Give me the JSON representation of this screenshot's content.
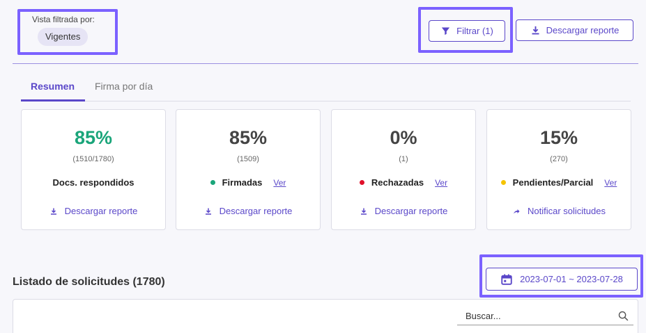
{
  "filter": {
    "label": "Vista filtrada por:",
    "chip": "Vigentes"
  },
  "toolbar": {
    "filter_button": "Filtrar (1)",
    "download_button": "Descargar reporte"
  },
  "tabs": [
    {
      "label": "Resumen",
      "active": true
    },
    {
      "label": "Firma por día",
      "active": false
    }
  ],
  "cards": [
    {
      "percent": "85%",
      "detail": "(1510/1780)",
      "label": "Docs. respondidos",
      "dot_color": "",
      "link": "",
      "action": "Descargar reporte",
      "action_icon": "download-icon"
    },
    {
      "percent": "85%",
      "detail": "(1509)",
      "label": "Firmadas",
      "dot_color": "#1aa57a",
      "link": "Ver",
      "action": "Descargar reporte",
      "action_icon": "download-icon"
    },
    {
      "percent": "0%",
      "detail": "(1)",
      "label": "Rechazadas",
      "dot_color": "#e0102a",
      "link": "Ver",
      "action": "Descargar reporte",
      "action_icon": "download-icon"
    },
    {
      "percent": "15%",
      "detail": "(270)",
      "label": "Pendientes/Parcial",
      "dot_color": "#f5c400",
      "link": "Ver",
      "action": "Notificar solicitudes",
      "action_icon": "share-arrow-icon"
    }
  ],
  "list": {
    "title": "Listado de solicitudes (1780)"
  },
  "date_range": {
    "label": "2023-07-01 ~ 2023-07-28"
  },
  "search": {
    "placeholder": "Buscar..."
  },
  "colors": {
    "accent": "#5a47c9",
    "highlight": "#7b61ff",
    "success": "#1aa57a"
  }
}
